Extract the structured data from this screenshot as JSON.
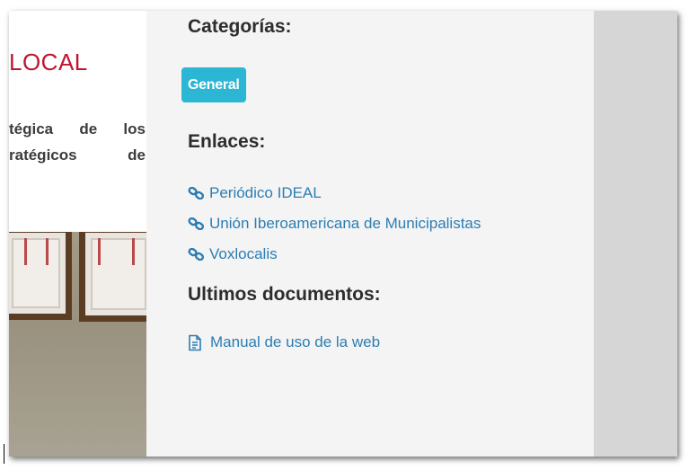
{
  "article": {
    "title_fragment": "LOCAL",
    "intro_lines": [
      [
        "tégica",
        "de",
        "los"
      ],
      [
        "ratégicos",
        "de"
      ]
    ]
  },
  "sidebar": {
    "categories_heading": "Categorías:",
    "category_tag": "General",
    "links_heading": "Enlaces:",
    "links": [
      {
        "label": "Periódico IDEAL",
        "icon": "link-icon"
      },
      {
        "label": "Unión Iberoamericana de Municipalistas",
        "icon": "link-icon"
      },
      {
        "label": "Voxlocalis",
        "icon": "link-icon"
      }
    ],
    "docs_heading": "Ultimos documentos:",
    "docs": [
      {
        "label": "Manual de uso de la web",
        "icon": "document-icon"
      }
    ]
  },
  "colors": {
    "accent_red": "#c0152f",
    "tag_bg": "#2bb6d4",
    "link": "#2c7db3",
    "sidebar_bg": "#f4f4f4"
  }
}
